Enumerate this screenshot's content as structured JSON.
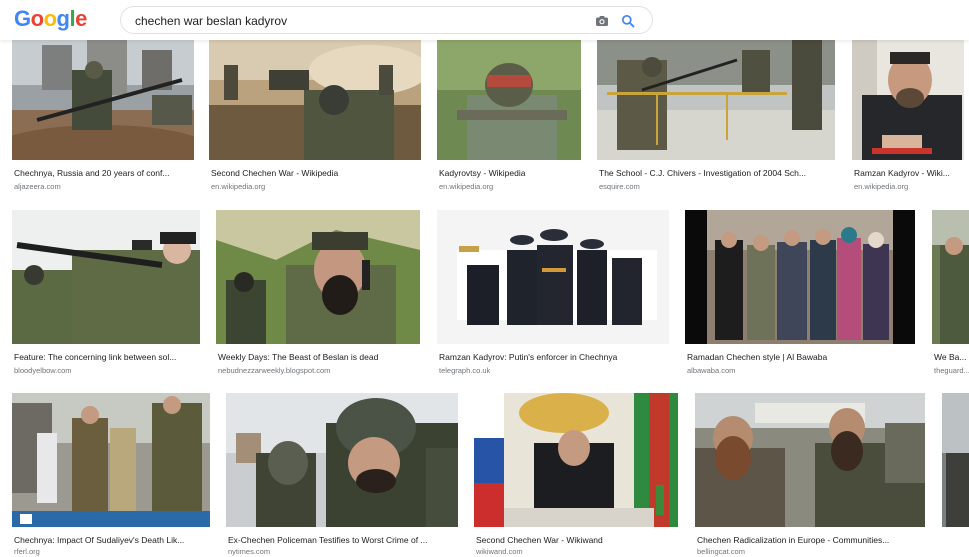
{
  "logo": {
    "letters": [
      "G",
      "o",
      "o",
      "g",
      "l",
      "e"
    ]
  },
  "colors": {
    "g_blue": "#4285F4",
    "g_red": "#EA4335",
    "g_yellow": "#FBBC05",
    "g_green": "#34A853"
  },
  "search": {
    "query": "chechen war beslan kadyrov",
    "camera_icon": "camera-icon",
    "search_icon": "search-icon"
  },
  "rows": [
    [
      {
        "title": "Chechnya, Russia and 20 years of conf...",
        "source": "aljazeera.com"
      },
      {
        "title": "Second Chechen War - Wikipedia",
        "source": "en.wikipedia.org"
      },
      {
        "title": "Kadyrovtsy - Wikipedia",
        "source": "en.wikipedia.org"
      },
      {
        "title": "The School - C.J. Chivers - Investigation of 2004 Sch...",
        "source": "esquire.com"
      },
      {
        "title": "Ramzan Kadyrov - Wiki...",
        "source": "en.wikipedia.org"
      }
    ],
    [
      {
        "title": "Feature: The concerning link between sol...",
        "source": "bloodyelbow.com"
      },
      {
        "title": "Weekly Days: The Beast of Beslan is dead",
        "source": "nebudnezzarweekly.blogspot.com"
      },
      {
        "title": "Ramzan Kadyrov: Putin's enforcer in Chechnya",
        "source": "telegraph.co.uk"
      },
      {
        "title": "Ramadan Chechen style | Al Bawaba",
        "source": "albawaba.com"
      },
      {
        "title": "We Ba...",
        "source": "theguard..."
      }
    ],
    [
      {
        "title": "Chechnya: Impact Of Sudaliyev's Death Lik...",
        "source": "rferl.org"
      },
      {
        "title": "Ex-Chechen Policeman Testifies to Worst Crime of ...",
        "source": "nytimes.com"
      },
      {
        "title": "Second Chechen War - Wikiwand",
        "source": "wikiwand.com"
      },
      {
        "title": "Chechen Radicalization in Europe - Communities...",
        "source": "bellingcat.com"
      },
      {
        "title": "",
        "source": ""
      }
    ]
  ]
}
